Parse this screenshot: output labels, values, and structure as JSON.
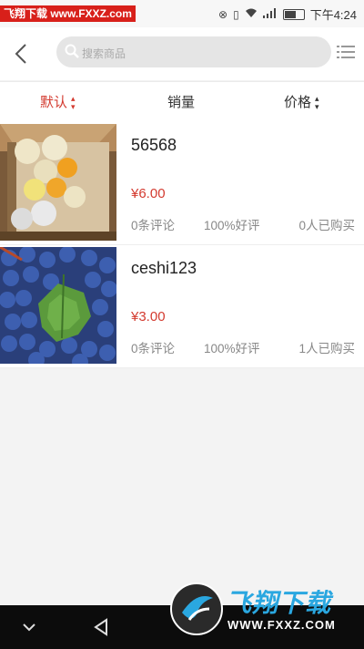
{
  "status_bar": {
    "watermark_badge": "飞翔下载 www.FXXZ.com",
    "time": "下午4:24"
  },
  "header": {
    "back_icon": "chevron-left-icon",
    "search_placeholder": "搜索商品",
    "menu_icon": "list-menu-icon"
  },
  "sort_bar": {
    "items": [
      {
        "label": "默认",
        "active": true
      },
      {
        "label": "销量",
        "active": false
      },
      {
        "label": "价格",
        "active": false
      }
    ],
    "active_color": "#d33a2f"
  },
  "products": [
    {
      "name": "56568",
      "price": "¥6.00",
      "reviews": "0条评论",
      "positive_rate": "100%好评",
      "buyers": "0人已购买",
      "image": "box-of-oranges-and-pears"
    },
    {
      "name": "ceshi123",
      "price": "¥3.00",
      "reviews": "0条评论",
      "positive_rate": "100%好评",
      "buyers": "1人已购买",
      "image": "bunch-of-blue-grapes"
    }
  ],
  "watermark": {
    "title": "飞翔下载",
    "url": "WWW.FXXZ.COM"
  }
}
